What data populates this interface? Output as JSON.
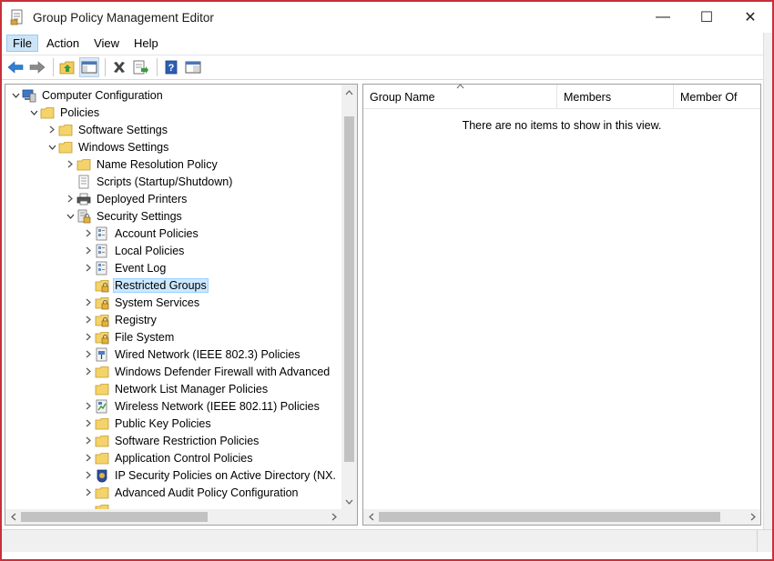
{
  "window": {
    "title": "Group Policy Management Editor",
    "minimize_glyph": "—",
    "maximize_glyph": "☐",
    "close_glyph": "✕"
  },
  "menu": {
    "file": "File",
    "action": "Action",
    "view": "View",
    "help": "Help"
  },
  "toolbar": {
    "icons": [
      "back-arrow-icon",
      "forward-arrow-icon",
      "up-folder-icon",
      "show-hide-tree-icon",
      "delete-icon",
      "export-list-icon",
      "help-icon",
      "properties-icon"
    ]
  },
  "tree": {
    "computer_configuration": "Computer Configuration",
    "policies": "Policies",
    "software_settings": "Software Settings",
    "windows_settings": "Windows Settings",
    "name_resolution_policy": "Name Resolution Policy",
    "scripts": "Scripts (Startup/Shutdown)",
    "deployed_printers": "Deployed Printers",
    "security_settings": "Security Settings",
    "account_policies": "Account Policies",
    "local_policies": "Local Policies",
    "event_log": "Event Log",
    "restricted_groups": "Restricted Groups",
    "system_services": "System Services",
    "registry": "Registry",
    "file_system": "File System",
    "wired_network": "Wired Network (IEEE 802.3) Policies",
    "windows_defender_firewall": "Windows Defender Firewall with Advanced",
    "network_list_manager": "Network List Manager Policies",
    "wireless_network": "Wireless Network (IEEE 802.11) Policies",
    "public_key_policies": "Public Key Policies",
    "software_restriction_policies": "Software Restriction Policies",
    "application_control_policies": "Application Control Policies",
    "ip_security_policies": "IP Security Policies on Active Directory (NX.",
    "advanced_audit_policy": "Advanced Audit Policy Configuration",
    "selected": "Restricted Groups"
  },
  "list": {
    "columns": {
      "group_name": "Group Name",
      "members": "Members",
      "member_of": "Member Of"
    },
    "empty_message": "There are no items to show in this view."
  },
  "colors": {
    "accent_border": "#c8303a",
    "selection": "#cce8ff",
    "folder": "#f4d36b"
  }
}
